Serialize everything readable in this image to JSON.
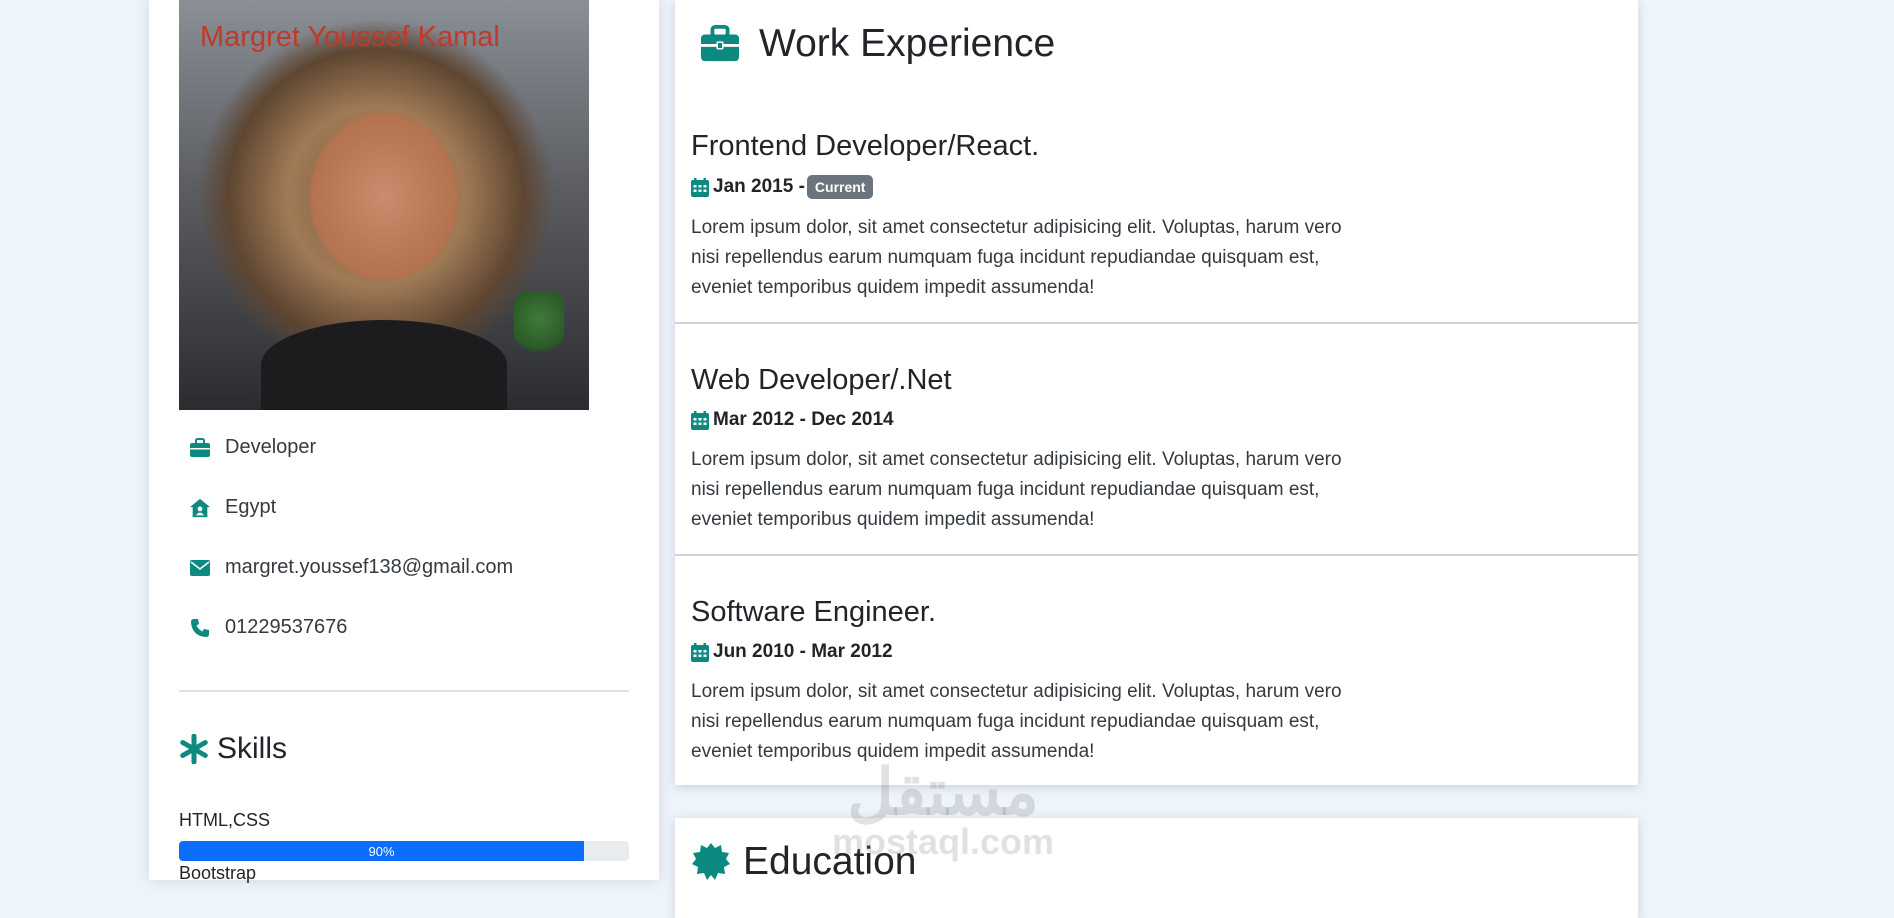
{
  "profile": {
    "name": "Margret Youssef Kamal",
    "photo_alt": "profile-photo",
    "job": "Developer",
    "country": "Egypt",
    "email": "margret.youssef138@gmail.com",
    "phone": "01229537676"
  },
  "skills": {
    "title": "Skills",
    "items": [
      {
        "name": "HTML,CSS",
        "percent": 90,
        "percent_label": "90%"
      },
      {
        "name": "Bootstrap"
      }
    ]
  },
  "experience": {
    "title": "Work Experience",
    "jobs": [
      {
        "title": "Frontend Developer/React.",
        "date": "Jan 2015 -",
        "badge": "Current",
        "description": "Lorem ipsum dolor, sit amet consectetur adipisicing elit. Voluptas, harum vero nisi repellendus earum numquam fuga incidunt repudiandae quisquam est, eveniet temporibus quidem impedit assumenda!"
      },
      {
        "title": "Web Developer/.Net",
        "date": "Mar 2012 - Dec 2014",
        "description": "Lorem ipsum dolor, sit amet consectetur adipisicing elit. Voluptas, harum vero nisi repellendus earum numquam fuga incidunt repudiandae quisquam est, eveniet temporibus quidem impedit assumenda!"
      },
      {
        "title": "Software Engineer.",
        "date": "Jun 2010 - Mar 2012",
        "description": "Lorem ipsum dolor, sit amet consectetur adipisicing elit. Voluptas, harum vero nisi repellendus earum numquam fuga incidunt repudiandae quisquam est, eveniet temporibus quidem impedit assumenda!"
      }
    ]
  },
  "education": {
    "title": "Education"
  },
  "watermark": {
    "arabic": "مستقل",
    "latin": "mostaql.com"
  },
  "colors": {
    "accent": "#0d8a7f",
    "progress": "#0d6efd",
    "badge": "#6c757d",
    "name": "#c0392b"
  },
  "icons": {
    "job": "briefcase-icon",
    "country": "house-user-icon",
    "email": "envelope-icon",
    "phone": "phone-icon",
    "skills": "asterisk-icon",
    "experience": "briefcase-icon",
    "date": "calendar-icon",
    "education": "certificate-icon"
  }
}
